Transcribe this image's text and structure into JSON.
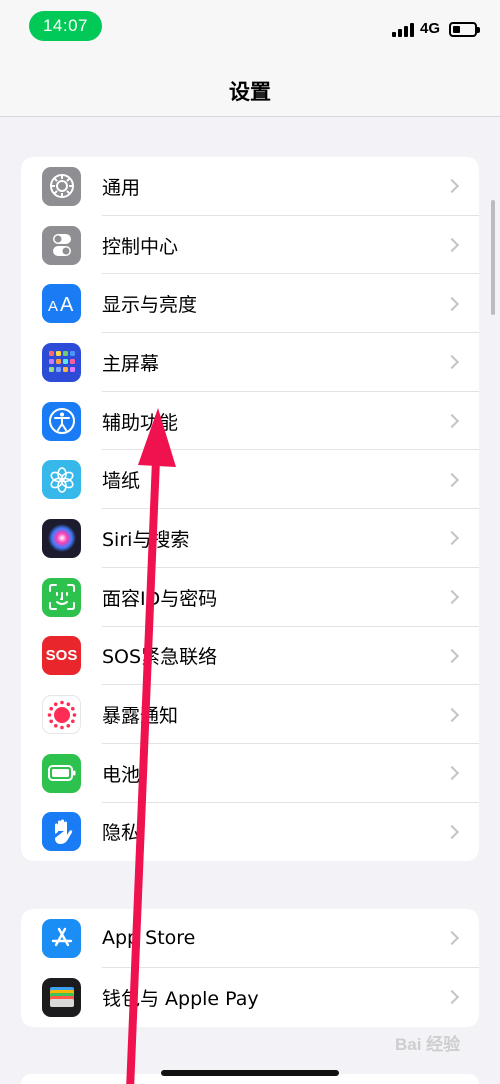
{
  "status": {
    "time": "14:07",
    "network": "4G"
  },
  "nav": {
    "title": "设置"
  },
  "group1": [
    {
      "label": "通用",
      "icon": "gear-icon",
      "color": "#8e8e93"
    },
    {
      "label": "控制中心",
      "icon": "toggles-icon",
      "color": "#8e8e93"
    },
    {
      "label": "显示与亮度",
      "icon": "text-size-icon",
      "color": "#1a7cf5"
    },
    {
      "label": "主屏幕",
      "icon": "app-grid-icon",
      "color": "#2c4bd6"
    },
    {
      "label": "辅助功能",
      "icon": "accessibility-icon",
      "color": "#1a7cf5"
    },
    {
      "label": "墙纸",
      "icon": "flower-icon",
      "color": "#36b9ea"
    },
    {
      "label": "Siri与搜索",
      "icon": "siri-icon",
      "color": "#1c1c2e"
    },
    {
      "label": "面容ID与密码",
      "icon": "face-id-icon",
      "color": "#2dc14e"
    },
    {
      "label": "SOS紧急联络",
      "icon": "sos-icon",
      "color": "#e8262b",
      "icon_text": "SOS"
    },
    {
      "label": "暴露通知",
      "icon": "exposure-icon",
      "color": "#ffffff"
    },
    {
      "label": "电池",
      "icon": "battery-icon",
      "color": "#2dc14e"
    },
    {
      "label": "隐私",
      "icon": "hand-icon",
      "color": "#1a7cf5"
    }
  ],
  "group2": [
    {
      "label": "App Store",
      "icon": "app-store-icon",
      "color": "#1a8ef5"
    },
    {
      "label": "钱包与 Apple Pay",
      "icon": "wallet-icon",
      "color": "#1c1c1e"
    }
  ],
  "watermark": "Bai 经验"
}
